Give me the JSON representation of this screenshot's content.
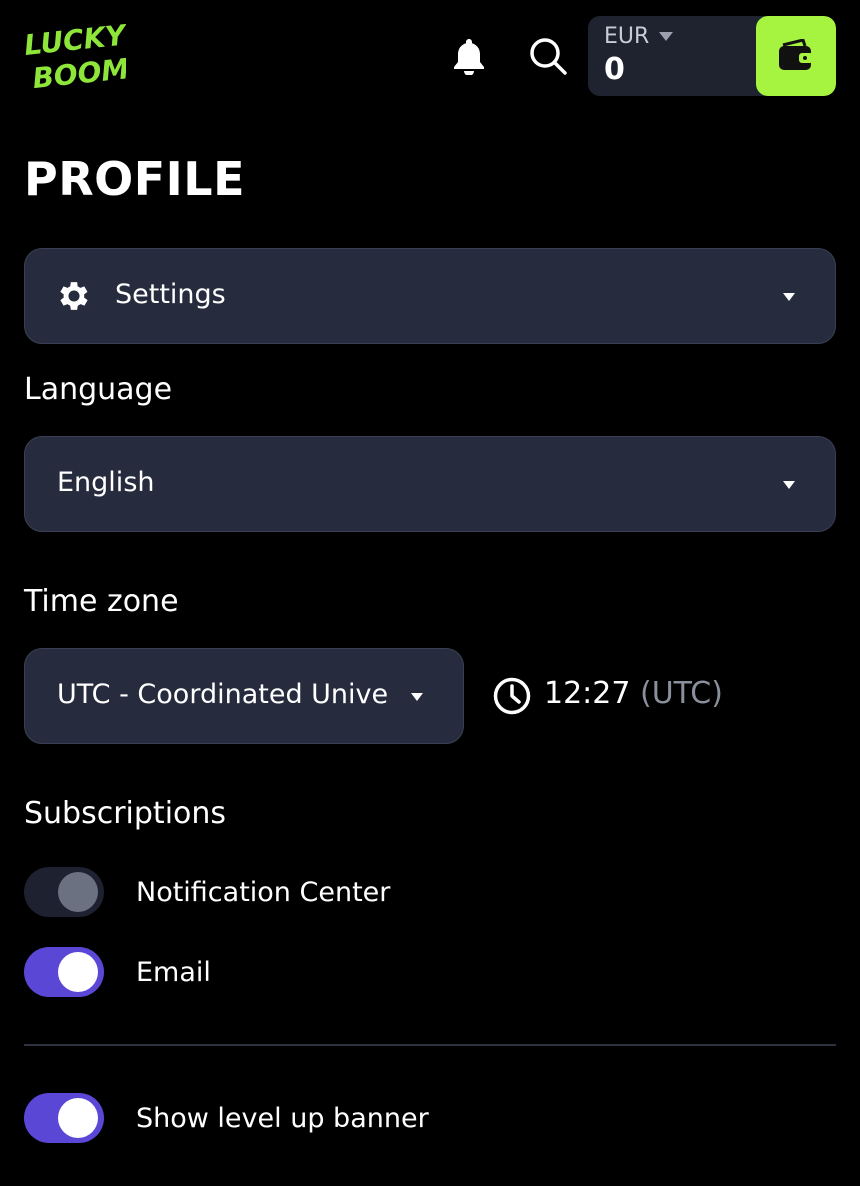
{
  "header": {
    "logo_text": "LUCKY BOOM",
    "balance": {
      "currency": "EUR",
      "amount": "0"
    }
  },
  "page": {
    "title": "PROFILE"
  },
  "section_select": {
    "label": "Settings"
  },
  "language": {
    "label": "Language",
    "value": "English"
  },
  "timezone": {
    "label": "Time zone",
    "value": "UTC - Coordinated Unive",
    "time": "12:27",
    "time_suffix": "(UTC)"
  },
  "subscriptions": {
    "label": "Subscriptions",
    "items": [
      {
        "label": "Notification Center",
        "enabled": false
      },
      {
        "label": "Email",
        "enabled": true
      }
    ]
  },
  "level_banner": {
    "label": "Show level up banner",
    "enabled": true
  },
  "colors": {
    "accent_green": "#a6f43f",
    "toggle_on": "#5b47d6",
    "panel": "#262b3d",
    "background": "#000000"
  },
  "icons": [
    "logo",
    "bell-icon",
    "search-icon",
    "wallet-icon",
    "gear-icon",
    "clock-icon",
    "chevron-down-icon"
  ]
}
